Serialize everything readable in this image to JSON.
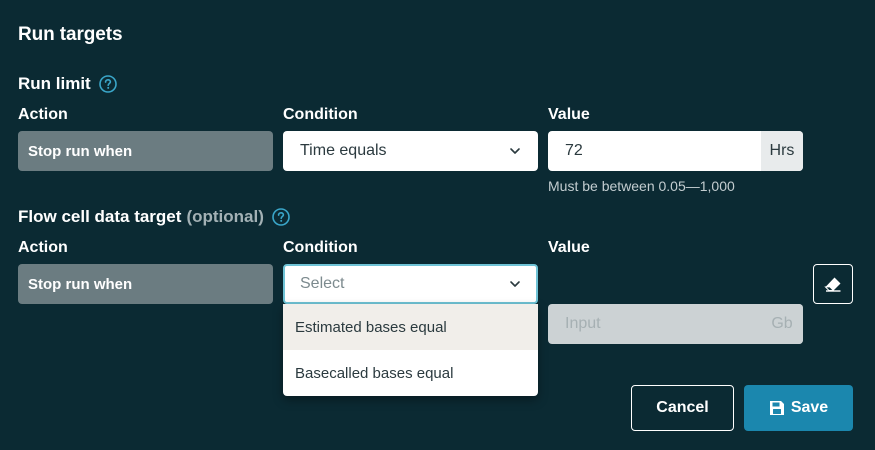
{
  "dialog": {
    "title": "Run targets"
  },
  "run_limit": {
    "title": "Run limit",
    "help_icon": "question-circle-icon",
    "labels": {
      "action": "Action",
      "condition": "Condition",
      "value": "Value"
    },
    "action_value": "Stop run when",
    "condition_value": "Time equals",
    "value": "72",
    "unit": "Hrs",
    "hint": "Must be between 0.05—1,000"
  },
  "flow_cell": {
    "title": "Flow cell data target",
    "optional": "(optional)",
    "help_icon": "question-circle-icon",
    "labels": {
      "action": "Action",
      "condition": "Condition",
      "value": "Value"
    },
    "action_value": "Stop run when",
    "condition_placeholder": "Select",
    "value_placeholder": "Input",
    "unit": "Gb",
    "clear_icon": "eraser-icon",
    "dropdown_options": [
      "Estimated bases equal",
      "Basecalled bases equal"
    ]
  },
  "buttons": {
    "cancel": "Cancel",
    "save": "Save",
    "save_icon": "floppy-disk-icon"
  },
  "colors": {
    "background": "#0b2a33",
    "accent": "#1b87ae",
    "focus_border": "#6fc3d6",
    "help_icon": "#3aa6c9"
  }
}
